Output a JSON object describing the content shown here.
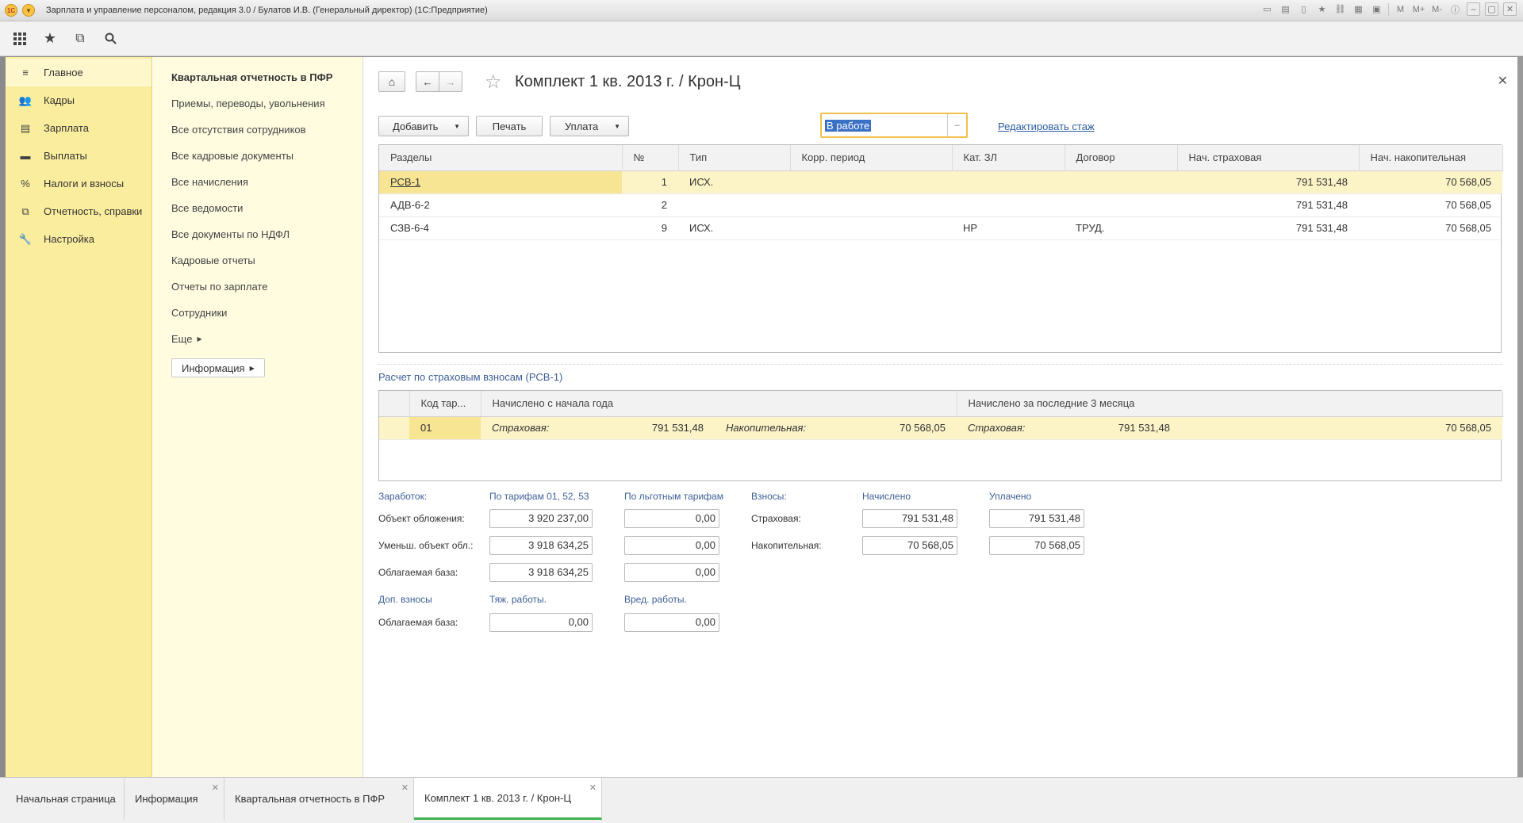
{
  "window": {
    "title": "Зарплата и управление персоналом, редакция 3.0 / Булатов И.В. (Генеральный директор)  (1С:Предприятие)",
    "logo": "1С"
  },
  "sections": [
    {
      "label": "Главное",
      "icon": "menu-lines-icon"
    },
    {
      "label": "Кадры",
      "icon": "people-icon"
    },
    {
      "label": "Зарплата",
      "icon": "wallet-icon"
    },
    {
      "label": "Выплаты",
      "icon": "cash-icon"
    },
    {
      "label": "Налоги и взносы",
      "icon": "percent-icon"
    },
    {
      "label": "Отчетность, справки",
      "icon": "report-icon"
    },
    {
      "label": "Настройка",
      "icon": "wrench-icon"
    }
  ],
  "nav": {
    "title": "Квартальная отчетность в ПФР",
    "items": [
      "Приемы, переводы, увольнения",
      "Все отсутствия сотрудников",
      "Все кадровые документы",
      "Все начисления",
      "Все ведомости",
      "Все документы по НДФЛ",
      "Кадровые отчеты",
      "Отчеты по зарплате",
      "Сотрудники"
    ],
    "more": "Еще",
    "info": "Информация"
  },
  "doc": {
    "title": "Комплект 1 кв. 2013 г. / Крон-Ц",
    "buttons": {
      "add": "Добавить",
      "print": "Печать",
      "pay": "Уплата"
    },
    "status": "В работе",
    "edit_link": "Редактировать стаж"
  },
  "sections_table": {
    "headers": [
      "Разделы",
      "№",
      "Тип",
      "Корр. период",
      "Кат. ЗЛ",
      "Договор",
      "Нач. страховая",
      "Нач. накопительная"
    ],
    "rows": [
      [
        "РСВ-1",
        "1",
        "ИСХ.",
        "",
        "",
        "",
        "791 531,48",
        "70 568,05"
      ],
      [
        "АДВ-6-2",
        "2",
        "",
        "",
        "",
        "",
        "791 531,48",
        "70 568,05"
      ],
      [
        "СЗВ-6-4",
        "9",
        "ИСХ.",
        "",
        "НР",
        "ТРУД.",
        "791 531,48",
        "70 568,05"
      ]
    ]
  },
  "calc": {
    "caption": "Расчет по страховым взносам (РСВ-1)",
    "headers": [
      "Код тар...",
      "Начислено с начала года",
      "Начислено за последние 3 месяца"
    ],
    "row": {
      "code": "01",
      "ytd_ins_label": "Страховая:",
      "ytd_ins": "791 531,48",
      "ytd_acc_label": "Накопительная:",
      "ytd_acc": "70 568,05",
      "q_ins_label": "Страховая:",
      "q_ins": "791 531,48",
      "q_acc": "70 568,05"
    }
  },
  "form": {
    "earnings_label": "Заработок:",
    "col_tariff": "По тарифам 01, 52, 53",
    "col_pref": "По льготным тарифам",
    "rows": [
      {
        "label": "Объект обложения:",
        "tariff": "3 920 237,00",
        "pref": "0,00"
      },
      {
        "label": "Уменьш. объект обл.:",
        "tariff": "3 918 634,25",
        "pref": "0,00"
      },
      {
        "label": "Облагаемая база:",
        "tariff": "3 918 634,25",
        "pref": "0,00"
      }
    ],
    "contrib_label": "Взносы:",
    "col_charged": "Начислено",
    "col_paid": "Уплачено",
    "contribs": [
      {
        "label": "Страховая:",
        "charged": "791 531,48",
        "paid": "791 531,48"
      },
      {
        "label": "Накопительная:",
        "charged": "70 568,05",
        "paid": "70 568,05"
      }
    ],
    "extra_label": "Доп. взносы",
    "col_heavy": "Тяж. работы.",
    "col_harm": "Вред. работы.",
    "extra_base_label": "Облагаемая база:",
    "extra_heavy": "0,00",
    "extra_harm": "0,00"
  },
  "tabs": [
    {
      "label": "Начальная страница"
    },
    {
      "label": "Информация"
    },
    {
      "label": "Квартальная отчетность в ПФР"
    },
    {
      "label": "Комплект 1 кв. 2013 г. / Крон-Ц"
    }
  ],
  "colors": {
    "section_bg": "#fbed9e",
    "nav_bg": "#fffce0",
    "accent_tab": "#3fb251",
    "link": "#2d5da7"
  }
}
